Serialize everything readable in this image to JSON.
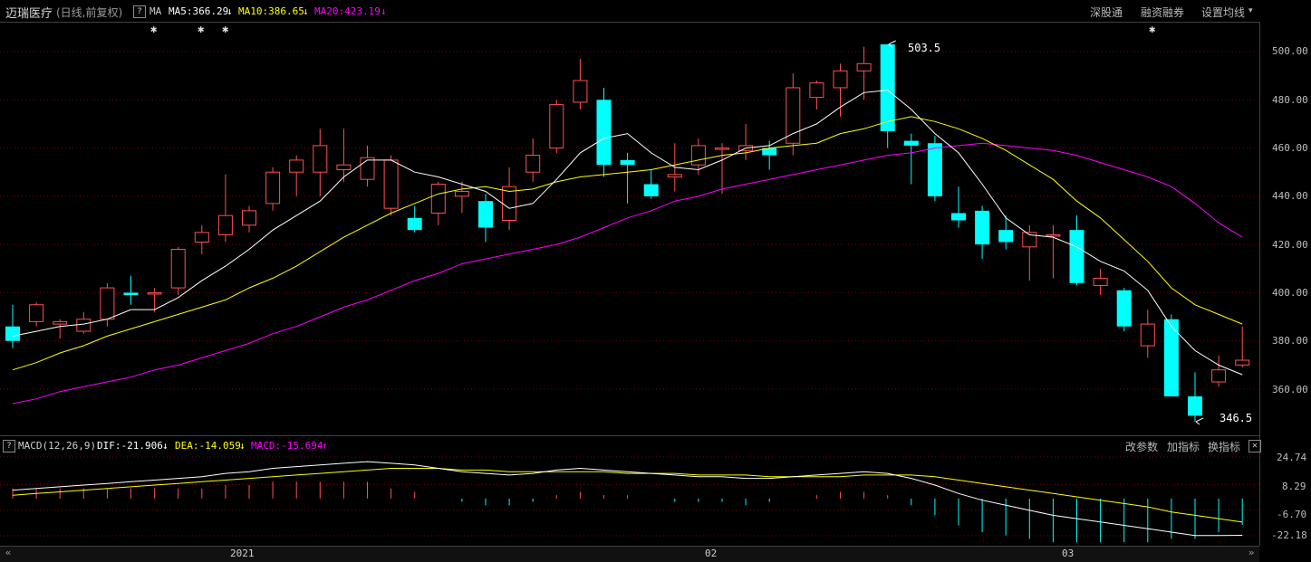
{
  "header": {
    "stock_name": "迈瑞医疗",
    "period_label": "(日线,前复权)",
    "help_label": "?",
    "ma_title": "MA",
    "ma5_label": "MA5:366.29",
    "ma10_label": "MA10:386.65",
    "ma20_label": "MA20:423.19",
    "ma5_arrow": "↓",
    "ma10_arrow": "↓",
    "ma20_arrow": "↓",
    "buttons": [
      "深股通",
      "融资融券",
      "设置均线"
    ],
    "dropdown_glyph": "▾",
    "star_glyph": "✱"
  },
  "colors": {
    "up": "#ff5050",
    "down": "#00ffff",
    "ma5": "#ffffff",
    "ma10": "#ffff00",
    "ma20": "#ff00ff",
    "grid": "#7a0000"
  },
  "price_axis": [
    "500.00",
    "480.00",
    "460.00",
    "440.00",
    "420.00",
    "400.00",
    "380.00",
    "360.00"
  ],
  "markers": {
    "high": "503.5",
    "low": "346.5"
  },
  "macd": {
    "help_label": "?",
    "title": "MACD(12,26,9)",
    "dif_label": "DIF:-21.906",
    "dea_label": "DEA:-14.059",
    "macd_label": "MACD:-15.694",
    "dif_arrow": "↓",
    "dea_arrow": "↓",
    "macd_arrow": "↑",
    "buttons": [
      "改参数",
      "加指标",
      "换指标"
    ],
    "close_label": "✕",
    "axis": [
      "24.74",
      "8.29",
      "-6.70",
      "-22.18"
    ]
  },
  "time_axis": {
    "labels": [
      "2021",
      "02",
      "03"
    ],
    "left_arrow": "«",
    "right_arrow": "»"
  },
  "chart_data": {
    "type": "candlestick",
    "ylim": [
      346.5,
      503.5
    ],
    "candles": [
      [
        386,
        395,
        377,
        380
      ],
      [
        388,
        396,
        386,
        395
      ],
      [
        387,
        389,
        381,
        388
      ],
      [
        384,
        392,
        383,
        389
      ],
      [
        389,
        404,
        386,
        402
      ],
      [
        400,
        407,
        395,
        399
      ],
      [
        400,
        402,
        392,
        400
      ],
      [
        402,
        419,
        399,
        418
      ],
      [
        421,
        428,
        416,
        425
      ],
      [
        424,
        449,
        421,
        432
      ],
      [
        428,
        436,
        425,
        434
      ],
      [
        437,
        452,
        434,
        450
      ],
      [
        450,
        457,
        440,
        455
      ],
      [
        450,
        468,
        440,
        461
      ],
      [
        451,
        468,
        446,
        453
      ],
      [
        447,
        461,
        444,
        456
      ],
      [
        435,
        457,
        432,
        455
      ],
      [
        431,
        436,
        425,
        426
      ],
      [
        433,
        446,
        428,
        445
      ],
      [
        440,
        446,
        433,
        442
      ],
      [
        438,
        441,
        421,
        427
      ],
      [
        430,
        452,
        426,
        444
      ],
      [
        450,
        464,
        446,
        457
      ],
      [
        460,
        480,
        458,
        478
      ],
      [
        479,
        497,
        476,
        488
      ],
      [
        480,
        485,
        448,
        453
      ],
      [
        455,
        458,
        437,
        453
      ],
      [
        445,
        451,
        439,
        440
      ],
      [
        448,
        462,
        442,
        449
      ],
      [
        453,
        464,
        449,
        461
      ],
      [
        460,
        462,
        441,
        460
      ],
      [
        459,
        470,
        455,
        461
      ],
      [
        460,
        463,
        451,
        457
      ],
      [
        462,
        491,
        457,
        485
      ],
      [
        481,
        488,
        476,
        487
      ],
      [
        485,
        495,
        473,
        492
      ],
      [
        492,
        502,
        480,
        495
      ],
      [
        503,
        503,
        460,
        467
      ],
      [
        463,
        466,
        445,
        461
      ],
      [
        462,
        465,
        438,
        440
      ],
      [
        433,
        444,
        427,
        430
      ],
      [
        434,
        436,
        414,
        420
      ],
      [
        426,
        432,
        418,
        421
      ],
      [
        419,
        428,
        405,
        425
      ],
      [
        424,
        428,
        406,
        424
      ],
      [
        426,
        432,
        403,
        404
      ],
      [
        403,
        410,
        399,
        406
      ],
      [
        401,
        402,
        384,
        386
      ],
      [
        378,
        393,
        373,
        387
      ],
      [
        389,
        391,
        357,
        357
      ],
      [
        357,
        367,
        346.5,
        349
      ],
      [
        363,
        374,
        361,
        368
      ],
      [
        370,
        386,
        369,
        372
      ]
    ],
    "ma5": [
      382,
      384,
      386,
      387,
      389,
      393,
      393,
      398,
      405,
      411,
      418,
      426,
      432,
      438,
      448,
      455,
      455,
      450,
      448,
      445,
      442,
      435,
      437,
      447,
      458,
      464,
      466,
      458,
      452,
      451,
      455,
      460,
      461,
      466,
      470,
      477,
      483,
      484,
      476,
      466,
      458,
      445,
      431,
      424,
      423,
      419,
      413,
      409,
      401,
      386,
      376,
      370,
      366
    ],
    "ma10": [
      368,
      371,
      375,
      378,
      382,
      385,
      388,
      391,
      394,
      397,
      402,
      406,
      411,
      417,
      423,
      428,
      433,
      437,
      441,
      443,
      444,
      442,
      443,
      446,
      448,
      449,
      450,
      451,
      453,
      455,
      457,
      458,
      460,
      461,
      462,
      466,
      468,
      471,
      473,
      471,
      468,
      464,
      459,
      453,
      447,
      438,
      431,
      422,
      413,
      402,
      395,
      391,
      387
    ],
    "ma20": [
      354,
      356,
      359,
      361,
      363,
      365,
      368,
      370,
      373,
      376,
      379,
      383,
      386,
      390,
      394,
      397,
      401,
      405,
      408,
      412,
      414,
      416,
      418,
      420,
      423,
      427,
      431,
      434,
      438,
      440,
      443,
      445,
      447,
      449,
      451,
      453,
      455,
      457,
      458,
      460,
      461,
      462,
      461,
      460,
      459,
      457,
      454,
      451,
      448,
      444,
      437,
      429,
      423
    ],
    "macd": {
      "dif": [
        5,
        6,
        7,
        8,
        9,
        10,
        11,
        12,
        13,
        15,
        16,
        18,
        19,
        20,
        21,
        22,
        21,
        20,
        18,
        16,
        15,
        14,
        15,
        17,
        18,
        17,
        16,
        15,
        14,
        13,
        13,
        12,
        12,
        13,
        14,
        15,
        16,
        15,
        12,
        8,
        3,
        -1,
        -4,
        -7,
        -10,
        -12,
        -14,
        -16,
        -18,
        -20,
        -22,
        -22,
        -21.906
      ],
      "dea": [
        2,
        3,
        4,
        5,
        6,
        7,
        8,
        9,
        10,
        11,
        12,
        13,
        14,
        15,
        16,
        17,
        18,
        18,
        18,
        17,
        17,
        16,
        16,
        16,
        16,
        16,
        15,
        15,
        15,
        14,
        14,
        14,
        13,
        13,
        13,
        13,
        14,
        14,
        14,
        13,
        11,
        9,
        7,
        5,
        3,
        1,
        -1,
        -3,
        -5,
        -8,
        -10,
        -12,
        -14.059
      ],
      "hist": [
        6,
        6,
        6,
        6,
        6,
        6,
        6,
        6,
        6,
        8,
        8,
        10,
        10,
        10,
        10,
        10,
        6,
        4,
        0,
        -2,
        -4,
        -4,
        -2,
        2,
        4,
        2,
        2,
        0,
        -2,
        -2,
        -2,
        -4,
        -2,
        0,
        2,
        4,
        4,
        2,
        -4,
        -10,
        -16,
        -20,
        -22,
        -24,
        -26,
        -26,
        -26,
        -26,
        -26,
        -24,
        -24,
        -20,
        -15.694
      ]
    }
  }
}
